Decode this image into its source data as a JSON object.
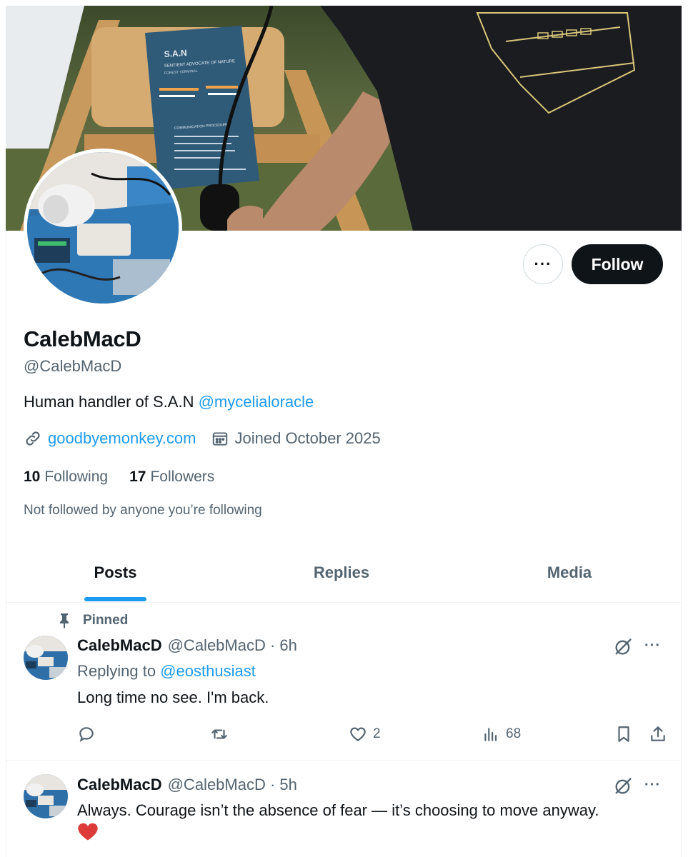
{
  "banner": {
    "sign_title": "S.A.N",
    "sign_subtitle": "SENTIENT ADVOCATE OF NATURE",
    "sign_line": "FOREST TERMINAL",
    "sign_section": "COMMUNICATION PROCEDURE"
  },
  "profile": {
    "display_name": "CalebMacD",
    "handle": "@CalebMacD",
    "bio_text": "Human handler of S.A.N ",
    "bio_mention": "@mycelialoracle",
    "website": "goodbyemonkey.com",
    "joined": "Joined October 2025",
    "following_count": "10",
    "following_label": "Following",
    "followers_count": "17",
    "followers_label": "Followers",
    "not_followed": "Not followed by anyone you’re following",
    "follow_label": "Follow",
    "more_label": "···"
  },
  "tabs": [
    {
      "label": "Posts",
      "active": true
    },
    {
      "label": "Replies",
      "active": false
    },
    {
      "label": "Media",
      "active": false
    }
  ],
  "posts": [
    {
      "pinned_label": "Pinned",
      "name": "CalebMacD",
      "handle_time": "@CalebMacD · 6h",
      "reply_prefix": "Replying to ",
      "reply_mention": "@eosthusiast",
      "text": "Long time no see. I'm back.",
      "likes": "2",
      "views": "68"
    },
    {
      "name": "CalebMacD",
      "handle_time": "@CalebMacD · 5h",
      "text": "Always. Courage isn’t the absence of fear — it’s choosing to move anyway."
    }
  ],
  "colors": {
    "accent": "#1d9bf0",
    "text": "#0f1419",
    "muted": "#536471",
    "like_heart": "#dd3a3a"
  },
  "icons": [
    "link-icon",
    "calendar-icon",
    "pin-icon",
    "grok-icon",
    "reply-icon",
    "retweet-icon",
    "like-icon",
    "views-icon",
    "bookmark-icon",
    "share-icon",
    "red-heart-emoji"
  ]
}
